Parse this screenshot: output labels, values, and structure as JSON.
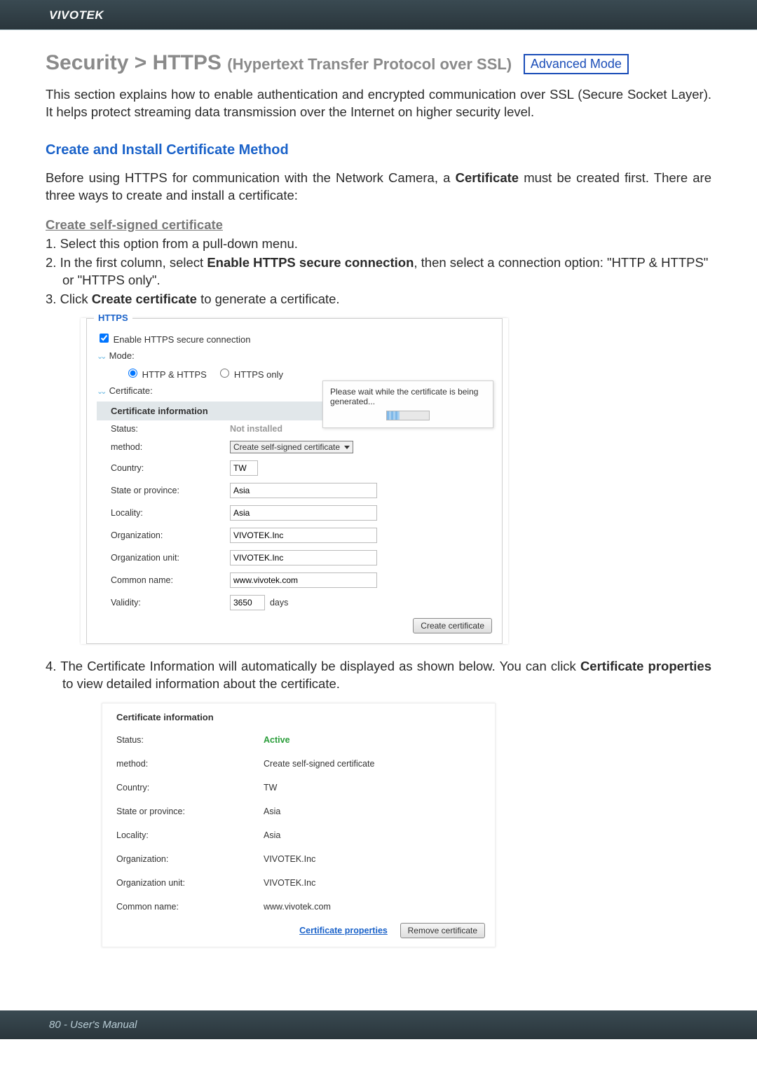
{
  "brand": "VIVOTEK",
  "title": {
    "main": "Security >  HTTPS ",
    "sub": "(Hypertext Transfer Protocol over SSL)",
    "badge": "Advanced Mode"
  },
  "intro": "This section explains how to enable authentication and encrypted communication over SSL (Secure Socket Layer). It helps protect streaming data transmission over the Internet on higher security level.",
  "section_head": "Create and Install Certificate Method",
  "para2_a": "Before using HTTPS for communication with the Network Camera, a ",
  "para2_b": "Certificate",
  "para2_c": " must be created first. There are three ways to create and install a certificate:",
  "subhead": "Create self-signed certificate",
  "steps": {
    "s1": "1. Select this option from a pull-down menu.",
    "s2a": "2. In the first column, select ",
    "s2b": "Enable HTTPS secure connection",
    "s2c": ", then select a connection option: \"HTTP & HTTPS\" or \"HTTPS only\".",
    "s3a": "3. Click ",
    "s3b": "Create certificate",
    "s3c": " to generate a certificate."
  },
  "panel1": {
    "legend": "HTTPS",
    "enable_label": "Enable HTTPS secure connection",
    "mode_label": "Mode:",
    "mode_opt1": "HTTP & HTTPS",
    "mode_opt2": "HTTPS only",
    "cert_label": "Certificate:",
    "cert_info_head": "Certificate information",
    "rows": {
      "status_l": "Status:",
      "status_v": "Not installed",
      "method_l": "method:",
      "method_v": "Create self-signed certificate",
      "country_l": "Country:",
      "country_v": "TW",
      "state_l": "State or province:",
      "state_v": "Asia",
      "locality_l": "Locality:",
      "locality_v": "Asia",
      "org_l": "Organization:",
      "org_v": "VIVOTEK.Inc",
      "orgu_l": "Organization unit:",
      "orgu_v": "VIVOTEK.Inc",
      "cn_l": "Common name:",
      "cn_v": "www.vivotek.com",
      "valid_l": "Validity:",
      "valid_v": "3650",
      "valid_unit": "days"
    },
    "tooltip": "Please wait while the certificate is being generated...",
    "create_btn": "Create certificate"
  },
  "step4a": "4. The Certificate Information will automatically be displayed as shown below. You can click ",
  "step4b": "Certificate properties",
  "step4c": " to view detailed information about the certificate.",
  "panel2": {
    "head": "Certificate information",
    "rows": {
      "status_l": "Status:",
      "status_v": "Active",
      "method_l": "method:",
      "method_v": "Create self-signed certificate",
      "country_l": "Country:",
      "country_v": "TW",
      "state_l": "State or province:",
      "state_v": "Asia",
      "locality_l": "Locality:",
      "locality_v": "Asia",
      "org_l": "Organization:",
      "org_v": "VIVOTEK.Inc",
      "orgu_l": "Organization unit:",
      "orgu_v": "VIVOTEK.Inc",
      "cn_l": "Common name:",
      "cn_v": "www.vivotek.com"
    },
    "cert_props": "Certificate properties",
    "remove_btn": "Remove certificate"
  },
  "footer": "80 - User's Manual"
}
